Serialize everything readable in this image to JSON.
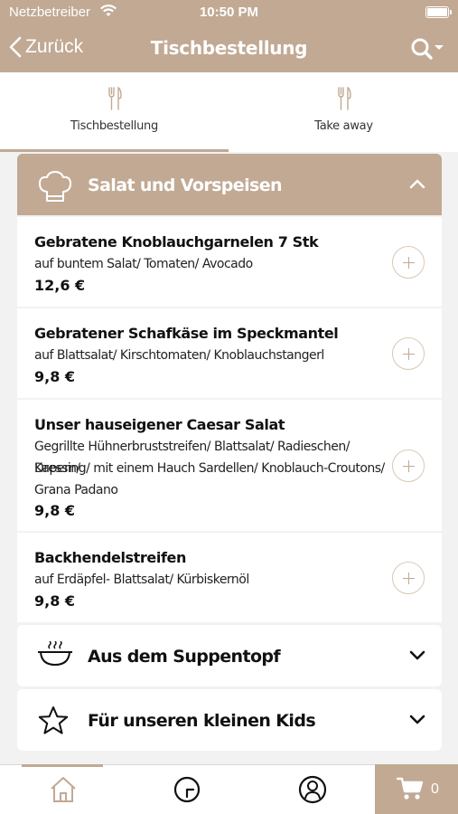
{
  "status_bar": {
    "carrier": "Netzbetreiber",
    "time": "10:50 PM"
  },
  "nav": {
    "back_label": "Zurück",
    "title": "Tischbestellung",
    "search_icon": "search-icon"
  },
  "tabs": [
    {
      "label": "Tischbestellung",
      "icon": "cutlery-icon",
      "active": true
    },
    {
      "label": "Take away",
      "icon": "cutlery-icon",
      "active": false
    }
  ],
  "categories": [
    {
      "title": "Salat und Vorspeisen",
      "icon": "chef-hat-icon",
      "expanded": true,
      "items": [
        {
          "name": "Gebratene Knoblauchgarnelen 7 Stk",
          "description": [
            "auf buntem Salat/ Tomaten/ Avocado"
          ],
          "price": "12,6 €"
        },
        {
          "name": "Gebratener Schafkäse im Speckmantel",
          "description": [
            "auf Blattsalat/ Kirschtomaten/ Knoblauchstangerl"
          ],
          "price": "9,8 €"
        },
        {
          "name": "Unser hauseigener Caesar Salat",
          "description": [
            "Gegrillte Hühnerbruststreifen/ Blattsalat/ Radieschen/ Kapern/",
            "Dressing/ mit einem Hauch Sardellen/ Knoblauch-Croutons/",
            "Grana Padano"
          ],
          "price": "9,8 €"
        },
        {
          "name": "Backhendelstreifen",
          "description": [
            "auf Erdäpfel- Blattsalat/ Kürbiskernöl"
          ],
          "price": "9,8 €"
        }
      ]
    },
    {
      "title": "Aus dem Suppentopf",
      "icon": "soup-bowl-icon",
      "expanded": false
    },
    {
      "title": "Für unseren kleinen Kids",
      "icon": "star-icon",
      "expanded": false
    }
  ],
  "bottom_nav": [
    {
      "icon": "home-icon"
    },
    {
      "icon": "clock-icon"
    },
    {
      "icon": "user-icon"
    }
  ],
  "cart": {
    "count": "0",
    "icon": "cart-icon"
  },
  "colors": {
    "accent": "#c1a993",
    "background": "#f2f2f2"
  }
}
